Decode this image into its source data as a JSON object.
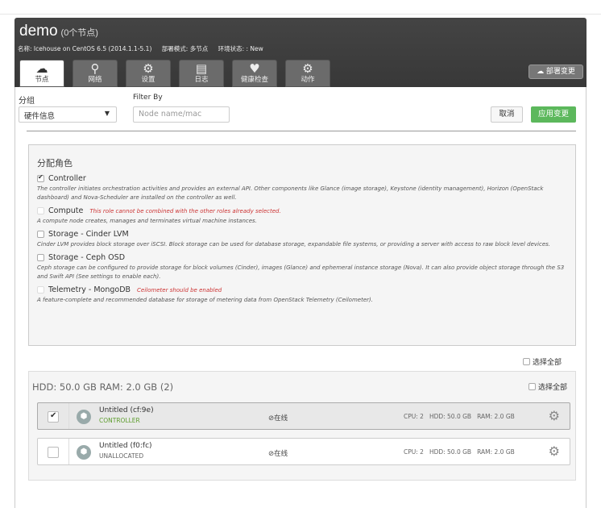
{
  "env": {
    "name": "demo",
    "node_count": "(0个节点)",
    "meta_name": "名称: Icehouse on CentOS 6.5 (2014.1.1-5.1)",
    "meta_mode": "部署模式: 多节点",
    "meta_status": "环境状态: : New"
  },
  "tabs": [
    {
      "label": "节点",
      "icon": "☁"
    },
    {
      "label": "网络",
      "icon": "⚲"
    },
    {
      "label": "设置",
      "icon": "⚙"
    },
    {
      "label": "日志",
      "icon": "▤"
    },
    {
      "label": "健康检查",
      "icon": "♥"
    },
    {
      "label": "动作",
      "icon": "⚙"
    }
  ],
  "deploy_label": "☁ 部署变更",
  "toolbar": {
    "group_label": "分组",
    "group_value": "硬件信息",
    "filter_label": "Filter By",
    "filter_placeholder": "Node name/mac",
    "cancel_label": "取消",
    "apply_label": "应用变更"
  },
  "roles": {
    "title": "分配角色",
    "items": [
      {
        "name": "Controller",
        "checked": true,
        "disabled": false,
        "warning": "",
        "desc": "The controller initiates orchestration activities and provides an external API. Other components like Glance (image storage), Keystone (identity management), Horizon (OpenStack dashboard) and Nova-Scheduler are installed on the controller as well."
      },
      {
        "name": "Compute",
        "checked": false,
        "disabled": true,
        "warning": "This role cannot be combined with the other roles already selected.",
        "desc": "A compute node creates, manages and terminates virtual machine instances."
      },
      {
        "name": "Storage - Cinder LVM",
        "checked": false,
        "disabled": false,
        "warning": "",
        "desc": "Cinder LVM provides block storage over iSCSI. Block storage can be used for database storage, expandable file systems, or providing a server with access to raw block level devices."
      },
      {
        "name": "Storage - Ceph OSD",
        "checked": false,
        "disabled": false,
        "warning": "",
        "desc": "Ceph storage can be configured to provide storage for block volumes (Cinder), images (Glance) and ephemeral instance storage (Nova). It can also provide object storage through the S3 and Swift API (See settings to enable each)."
      },
      {
        "name": "Telemetry - MongoDB",
        "checked": false,
        "disabled": true,
        "warning": "Ceilometer should be enabled",
        "desc": "A feature-complete and recommended database for storage of metering data from OpenStack Telemetry (Ceilometer)."
      }
    ]
  },
  "select_all_label": "选择全部",
  "node_group": {
    "title": "HDD: 50.0 GB  RAM: 2.0 GB (2)",
    "select_all_label": "选择全部",
    "nodes": [
      {
        "name": "Untitled (cf:9e)",
        "role": "CONTROLLER",
        "status": "⊘在线",
        "cpu": "CPU: 2",
        "hdd": "HDD: 50.0 GB",
        "ram": "RAM: 2.0 GB",
        "selected": true
      },
      {
        "name": "Untitled (f0:fc)",
        "role": "UNALLOCATED",
        "status": "⊘在线",
        "cpu": "CPU: 2",
        "hdd": "HDD: 50.0 GB",
        "ram": "RAM: 2.0 GB",
        "selected": false
      }
    ]
  }
}
